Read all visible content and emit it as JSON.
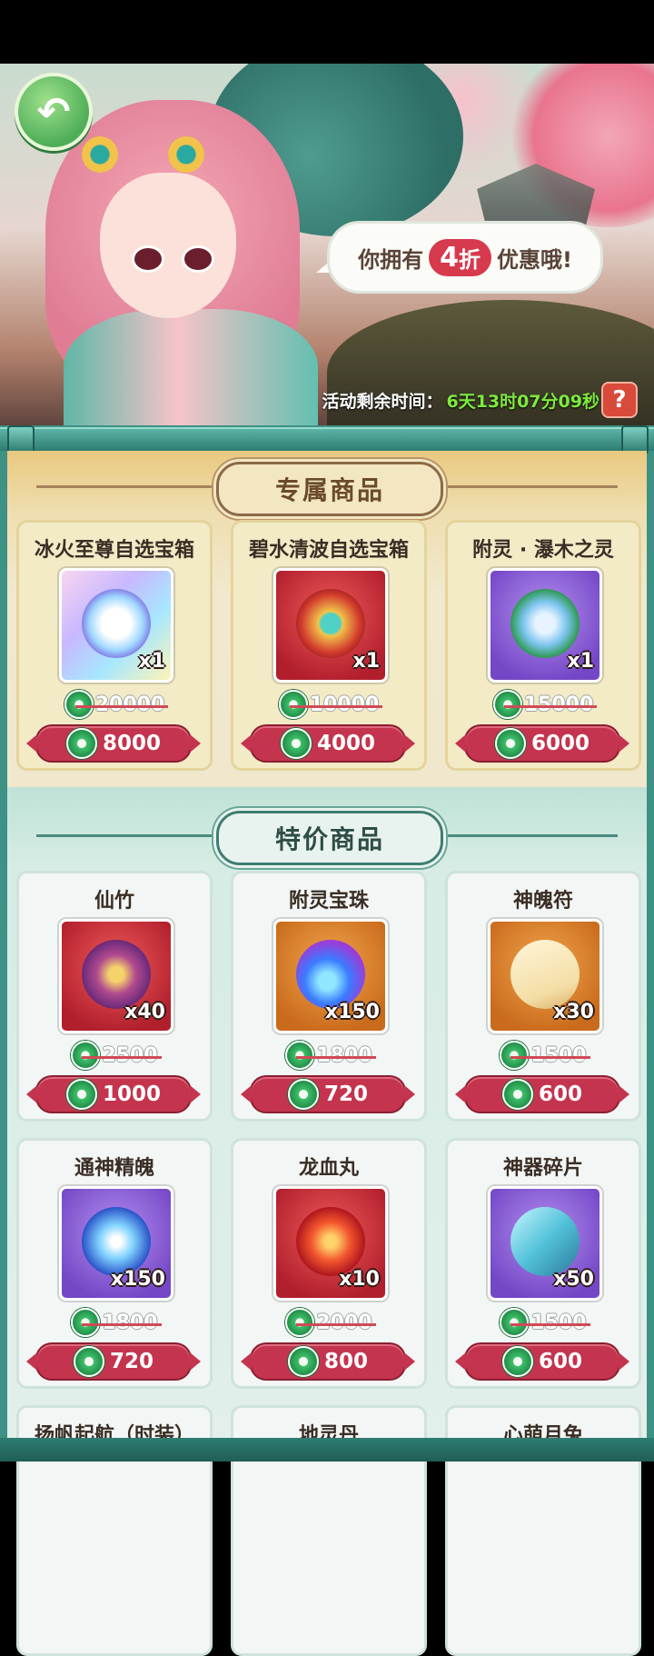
{
  "banner": {
    "bubble_prefix": "你拥有",
    "discount_number": "4",
    "discount_unit": "折",
    "bubble_suffix": "优惠哦!",
    "timer_label": "活动剩余时间：",
    "timer_value": "6天13时07分09秒",
    "help_label": "?"
  },
  "exclusive": {
    "title": "专属商品",
    "items": [
      {
        "name": "冰火至尊自选宝箱",
        "icon": "silver-chest-icon",
        "qty": "x1",
        "original": "20000",
        "price": "8000"
      },
      {
        "name": "碧水清波自选宝箱",
        "icon": "red-chest-icon",
        "qty": "x1",
        "original": "10000",
        "price": "4000"
      },
      {
        "name": "附灵 · 瀑木之灵",
        "icon": "wood-spirit-icon",
        "qty": "x1",
        "original": "15000",
        "price": "6000"
      }
    ]
  },
  "special": {
    "title": "特价商品",
    "items": [
      {
        "name": "仙竹",
        "icon": "dragon-icon",
        "qty": "x40",
        "original": "2500",
        "price": "1000"
      },
      {
        "name": "附灵宝珠",
        "icon": "spirit-orb-icon",
        "qty": "x150",
        "original": "1800",
        "price": "720"
      },
      {
        "name": "神魄符",
        "icon": "talisman-scroll-icon",
        "qty": "x30",
        "original": "1500",
        "price": "600"
      },
      {
        "name": "通神精魄",
        "icon": "blue-soul-orb-icon",
        "qty": "x150",
        "original": "1800",
        "price": "720"
      },
      {
        "name": "龙血丸",
        "icon": "dragon-blood-pill-icon",
        "qty": "x10",
        "original": "2000",
        "price": "800"
      },
      {
        "name": "神器碎片",
        "icon": "crystal-shard-icon",
        "qty": "x50",
        "original": "1500",
        "price": "600"
      },
      {
        "name": "扬帆起航（时装）",
        "icon": "",
        "qty": "",
        "original": "",
        "price": ""
      },
      {
        "name": "地灵丹",
        "icon": "",
        "qty": "",
        "original": "",
        "price": ""
      },
      {
        "name": "心萌月兔",
        "icon": "",
        "qty": "",
        "original": "",
        "price": ""
      }
    ]
  },
  "colors": {
    "accent_red": "#c4344e",
    "timer_green": "#7dea3f",
    "frame_teal": "#3d9185"
  }
}
